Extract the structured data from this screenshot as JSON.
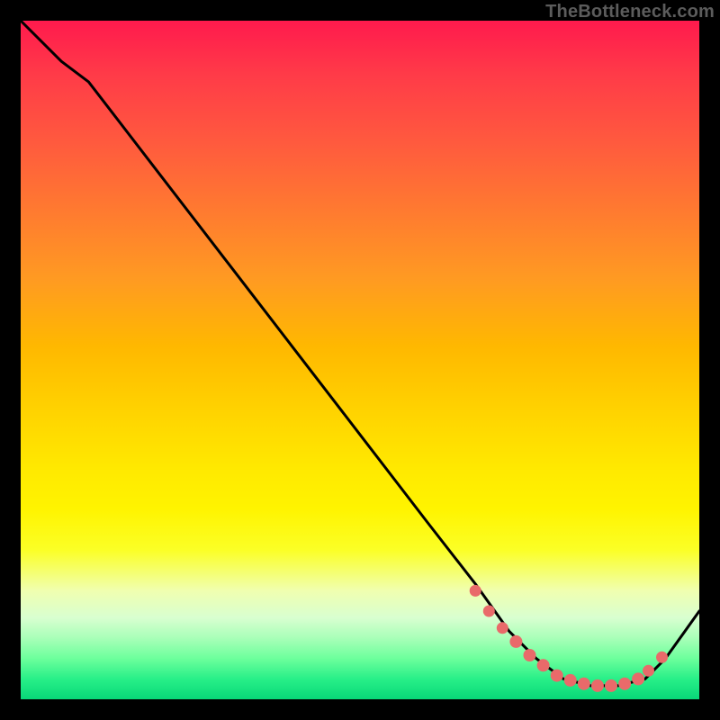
{
  "attribution": "TheBottleneck.com",
  "chart_data": {
    "type": "line",
    "title": "",
    "xlabel": "",
    "ylabel": "",
    "xlim": [
      0,
      100
    ],
    "ylim": [
      0,
      100
    ],
    "series": [
      {
        "name": "bottleneck-curve",
        "x": [
          0,
          6,
          10,
          20,
          30,
          40,
          50,
          60,
          67,
          72,
          76,
          80,
          84,
          88,
          92,
          95,
          100
        ],
        "y": [
          100,
          94,
          91,
          78,
          65,
          52,
          39,
          26,
          17,
          10,
          6,
          3,
          2,
          2,
          3,
          6,
          13
        ]
      }
    ],
    "markers": {
      "name": "highlight-cluster",
      "color": "#e96a6a",
      "points_x": [
        67,
        69,
        71,
        73,
        75,
        77,
        79,
        81,
        83,
        85,
        87,
        89,
        91,
        92.5,
        94.5
      ],
      "points_y": [
        16,
        13,
        10.5,
        8.5,
        6.5,
        5,
        3.5,
        2.8,
        2.3,
        2,
        2,
        2.3,
        3,
        4.2,
        6.2
      ]
    }
  }
}
